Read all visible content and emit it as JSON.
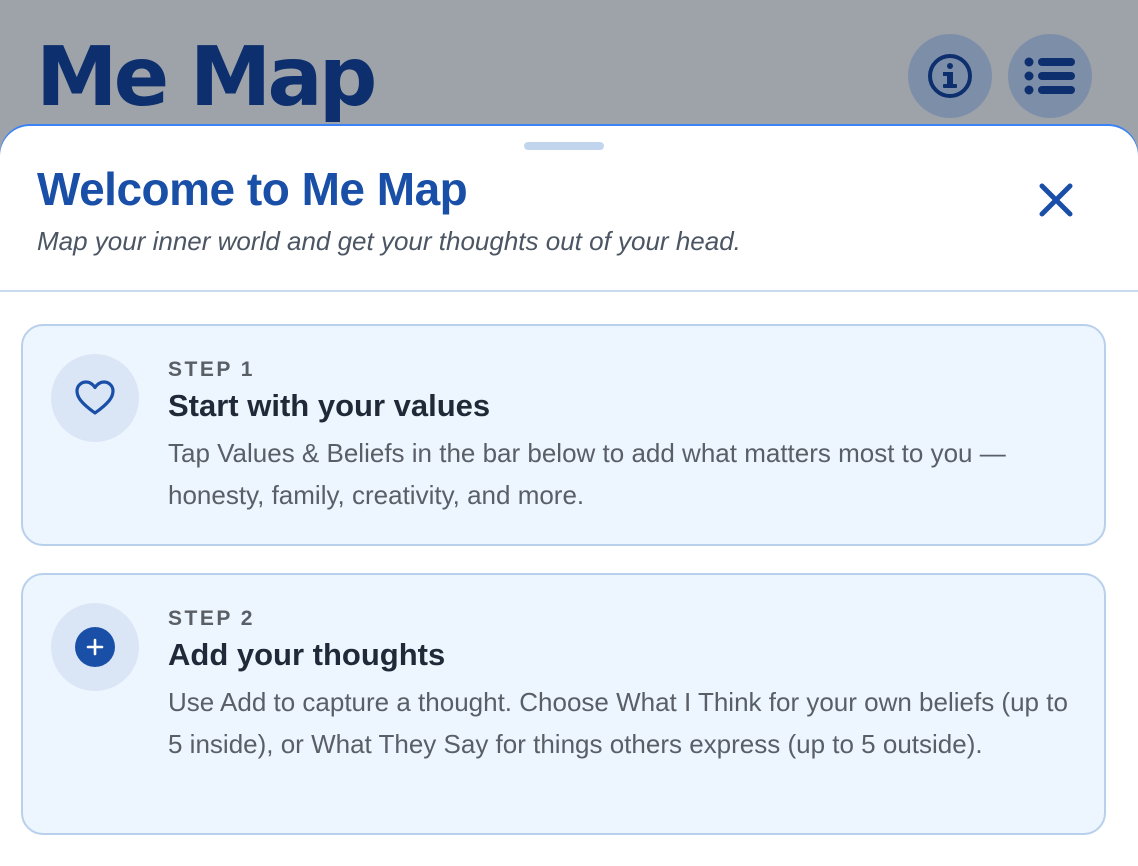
{
  "app": {
    "title": "Me Map",
    "info_icon": "info-circle-icon",
    "menu_icon": "list-menu-icon"
  },
  "sheet": {
    "title": "Welcome to Me Map",
    "subtitle": "Map your inner world and get your thoughts out of your head.",
    "close_icon": "close-icon"
  },
  "steps": [
    {
      "label": "STEP 1",
      "heading": "Start with your values",
      "body": "Tap Values & Beliefs in the bar below to add what matters most to you — honesty, family, creativity, and more.",
      "icon": "heart-icon"
    },
    {
      "label": "STEP 2",
      "heading": "Add your thoughts",
      "body": "Use Add to capture a thought. Choose What I Think for your own beliefs (up to 5 inside), or What They Say for things others express (up to 5 outside).",
      "icon": "plus-circle-icon"
    }
  ],
  "colors": {
    "header_bg": "#9ea3a9",
    "brand_dark": "#0d2f6e",
    "accent": "#1a4fa8",
    "card_bg": "#edf5ff",
    "card_border": "#b9d0ec"
  }
}
